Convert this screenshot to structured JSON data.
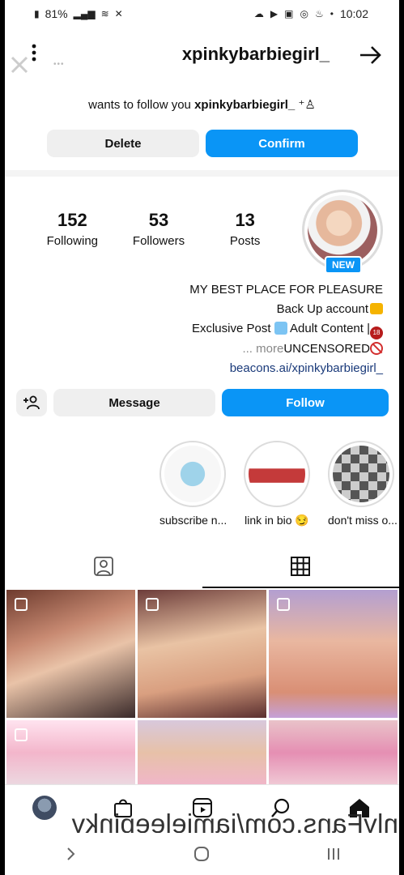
{
  "status_bar": {
    "time": "10:02",
    "battery": "81%"
  },
  "header": {
    "username": "xpinkybarbiegirl_"
  },
  "follow_request": {
    "username": "xpinkybarbiegirl_",
    "text": "wants to follow you",
    "confirm_label": "Confirm",
    "delete_label": "Delete"
  },
  "profile": {
    "new_badge": "NEW",
    "stats": [
      {
        "value": "13",
        "label": "Posts"
      },
      {
        "value": "53",
        "label": "Followers"
      },
      {
        "value": "152",
        "label": "Following"
      }
    ],
    "bio": {
      "line1": "MY BEST PLACE FOR PLEASURE",
      "line2": "Back Up account",
      "line3a": "Adult Content |",
      "line3b": "Exclusive Post",
      "line4": "UNCENSORED",
      "more": "... more",
      "link": "beacons.ai/xpinkybarbiegirl_"
    },
    "follow_label": "Follow",
    "message_label": "Message"
  },
  "highlights": [
    {
      "label": "don't miss o..."
    },
    {
      "label": "link in bio 😏"
    },
    {
      "label": "subscribe n..."
    }
  ],
  "watermark": "OnlyFans.com/jamieleepinky",
  "colors": {
    "primary_button": "#0a95f6",
    "secondary_button": "#efefef"
  }
}
